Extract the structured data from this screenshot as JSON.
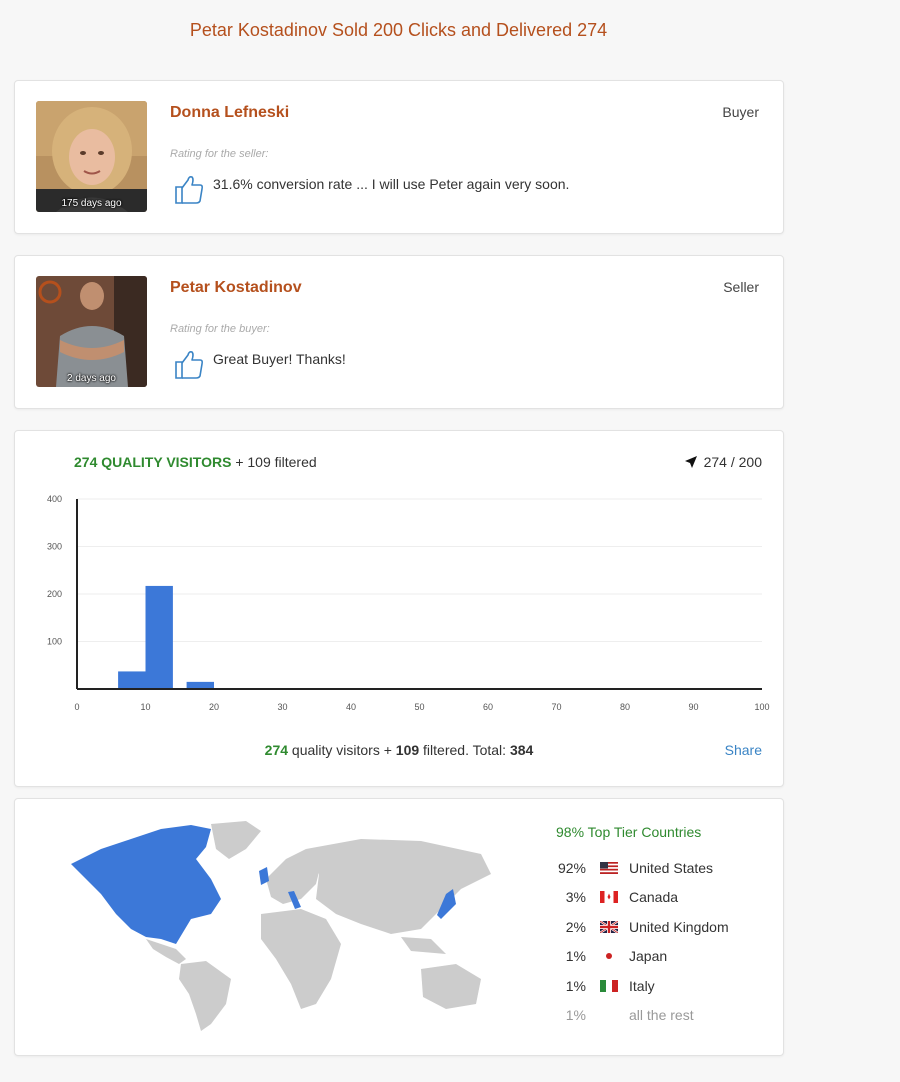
{
  "headline": "Petar Kostadinov Sold 200 Clicks and Delivered 274",
  "reviews": [
    {
      "name": "Donna Lefneski",
      "role": "Buyer",
      "ago": "175 days ago",
      "rating_label": "Rating for the seller:",
      "text": "31.6% conversion rate ... I will use Peter again very soon."
    },
    {
      "name": "Petar Kostadinov",
      "role": "Seller",
      "ago": "2 days ago",
      "rating_label": "Rating for the buyer:",
      "text": "Great Buyer! Thanks!"
    }
  ],
  "stats": {
    "quality_heading": "274 QUALITY VISITORS",
    "filtered_heading": "+ 109 filtered",
    "delivered": "274 / 200",
    "summary_quality": "274",
    "summary_quality_text": "quality visitors +",
    "summary_filtered": "109",
    "summary_filtered_text": "filtered. Total:",
    "summary_total": "384",
    "share_label": "Share"
  },
  "chart_data": {
    "type": "bar",
    "x": [
      8,
      12,
      18
    ],
    "values": [
      37,
      217,
      15
    ],
    "xlim": [
      0,
      100
    ],
    "ylim": [
      0,
      400
    ],
    "x_ticks": [
      0,
      10,
      20,
      30,
      40,
      50,
      60,
      70,
      80,
      90,
      100
    ],
    "y_ticks": [
      100,
      200,
      300,
      400
    ],
    "bar_color": "#3c78d8",
    "grid": true
  },
  "geo": {
    "top_tier": "98% Top Tier Countries",
    "countries": [
      {
        "pct": "92%",
        "name": "United States",
        "flag": "flag-us-icon"
      },
      {
        "pct": "3%",
        "name": "Canada",
        "flag": "flag-ca-icon"
      },
      {
        "pct": "2%",
        "name": "United Kingdom",
        "flag": "flag-gb-icon"
      },
      {
        "pct": "1%",
        "name": "Japan",
        "flag": "flag-jp-icon"
      },
      {
        "pct": "1%",
        "name": "Italy",
        "flag": "flag-it-icon"
      }
    ],
    "rest_pct": "1%",
    "rest_label": "all the rest",
    "highlight_color": "#3c78d8",
    "land_color": "#cccccc"
  }
}
